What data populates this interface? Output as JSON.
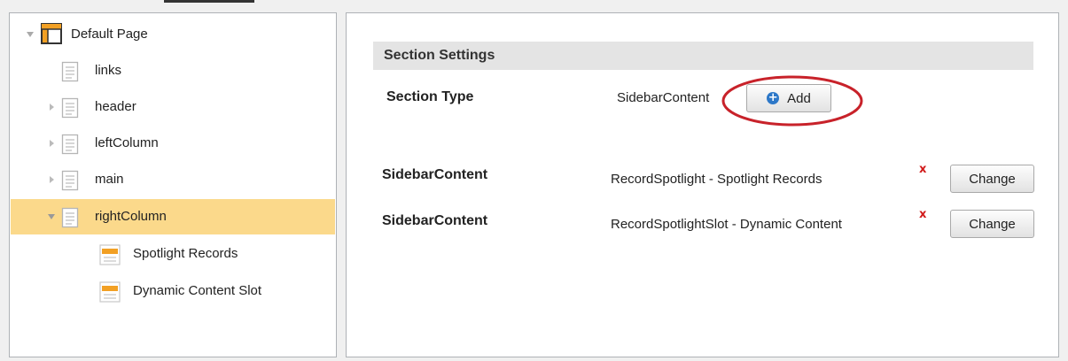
{
  "tree": {
    "root": {
      "label": "Default Page",
      "icon": "page-layout-icon"
    },
    "items": [
      {
        "label": "links",
        "icon": "document-icon",
        "expander": "none"
      },
      {
        "label": "header",
        "icon": "document-icon",
        "expander": "collapsed"
      },
      {
        "label": "leftColumn",
        "icon": "document-icon",
        "expander": "collapsed"
      },
      {
        "label": "main",
        "icon": "document-icon",
        "expander": "collapsed"
      },
      {
        "label": "rightColumn",
        "icon": "document-icon",
        "expander": "expanded",
        "selected": true
      },
      {
        "label": "Spotlight Records",
        "icon": "content-slot-icon"
      },
      {
        "label": "Dynamic Content Slot",
        "icon": "content-slot-icon"
      }
    ]
  },
  "settings": {
    "header": "Section Settings",
    "section_type_label": "Section Type",
    "section_type_value": "SidebarContent",
    "add_label": "Add",
    "rows": [
      {
        "label": "SidebarContent",
        "value": "RecordSpotlight - Spotlight Records",
        "remove": "x",
        "action": "Change"
      },
      {
        "label": "SidebarContent",
        "value": "RecordSpotlightSlot - Dynamic Content",
        "remove": "x",
        "action": "Change"
      }
    ]
  },
  "colors": {
    "selected_row": "#fbd98b",
    "remove_x": "#d11a1a",
    "highlight_ellipse": "#c8222a",
    "add_icon": "#2d78c8"
  }
}
